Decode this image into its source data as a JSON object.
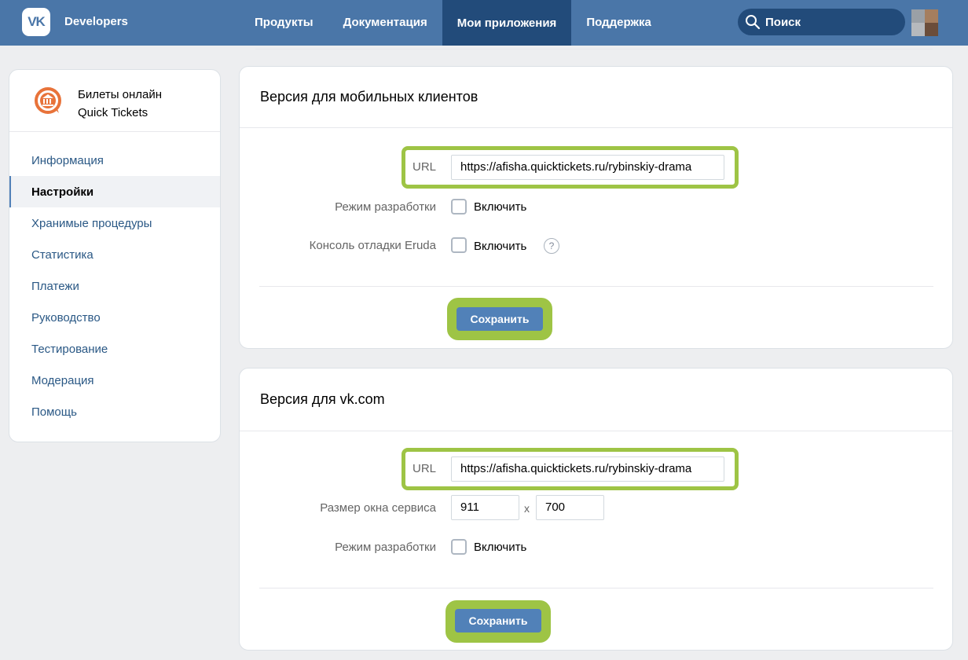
{
  "header": {
    "logo_text": "VK",
    "brand": "Developers",
    "nav": [
      "Продукты",
      "Документация",
      "Мои приложения",
      "Поддержка"
    ],
    "search_placeholder": "Поиск",
    "accent_color": "#4a76a8",
    "active_nav_color": "#224b7a"
  },
  "sidebar": {
    "app_name_line1": "Билеты онлайн",
    "app_name_line2": "Quick Tickets",
    "items": [
      {
        "label": "Информация"
      },
      {
        "label": "Настройки"
      },
      {
        "label": "Хранимые процедуры"
      },
      {
        "label": "Статистика"
      },
      {
        "label": "Платежи"
      },
      {
        "label": "Руководство"
      },
      {
        "label": "Тестирование"
      },
      {
        "label": "Модерация"
      },
      {
        "label": "Помощь"
      }
    ]
  },
  "mobile_section": {
    "title": "Версия для мобильных клиентов",
    "url_label": "URL",
    "url_value": "https://afisha.quicktickets.ru/rybinskiy-drama",
    "dev_mode_label": "Режим разработки",
    "dev_mode_checkbox": "Включить",
    "eruda_label": "Консоль отладки Eruda",
    "eruda_checkbox": "Включить",
    "help_glyph": "?",
    "save_label": "Сохранить"
  },
  "vk_section": {
    "title": "Версия для vk.com",
    "url_label": "URL",
    "url_value": "https://afisha.quicktickets.ru/rybinskiy-drama",
    "size_label": "Размер окна сервиса",
    "width_value": "911",
    "separator": "x",
    "height_value": "700",
    "dev_mode_label": "Режим разработки",
    "dev_mode_checkbox": "Включить",
    "save_label": "Сохранить"
  },
  "highlight_color": "#9ec445"
}
